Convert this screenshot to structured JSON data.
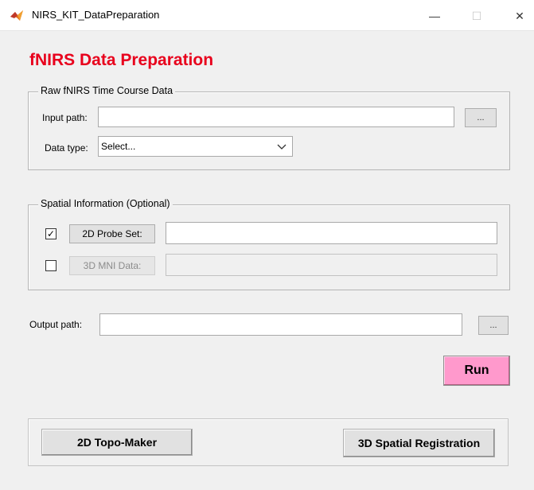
{
  "window": {
    "title": "NIRS_KIT_DataPreparation",
    "minimize_glyph": "—",
    "maximize_glyph": "☐",
    "close_glyph": "✕"
  },
  "page_title": "fNIRS Data Preparation",
  "raw_group": {
    "legend": "Raw fNIRS Time Course Data",
    "input_path_label": "Input path:",
    "input_path_value": "",
    "browse_label": "...",
    "data_type_label": "Data type:",
    "data_type_selected": "Select..."
  },
  "spatial_group": {
    "legend": "Spatial Information (Optional)",
    "probe2d": {
      "checked": true,
      "check_glyph": "✓",
      "button_label": "2D Probe Set:",
      "value": ""
    },
    "mni3d": {
      "checked": false,
      "check_glyph": "",
      "button_label": "3D MNI Data:",
      "value": ""
    }
  },
  "output": {
    "label": "Output path:",
    "value": "",
    "browse_label": "..."
  },
  "run_label": "Run",
  "bottom": {
    "topo_label": "2D Topo-Maker",
    "spatial_reg_label": "3D Spatial Registration"
  },
  "colors": {
    "title_red": "#e8001c",
    "run_pink": "#ff99cc",
    "window_bg": "#f0f0f0"
  },
  "icons": {
    "app": "matlab-logo-icon",
    "dropdown": "chevron-down-icon"
  }
}
